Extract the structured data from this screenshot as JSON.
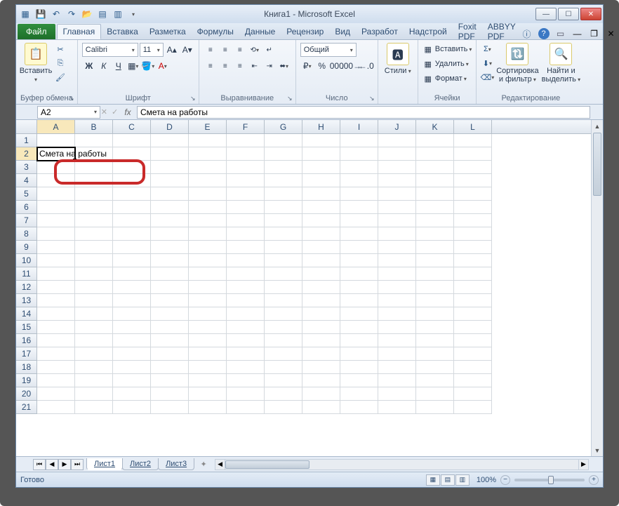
{
  "title": "Книга1  -  Microsoft Excel",
  "tabs": {
    "file": "Файл",
    "list": [
      "Главная",
      "Вставка",
      "Разметка",
      "Формулы",
      "Данные",
      "Рецензир",
      "Вид",
      "Разработ",
      "Надстрой",
      "Foxit PDF",
      "ABBYY PDF"
    ],
    "active": "Главная"
  },
  "ribbon": {
    "clipboard": {
      "paste": "Вставить",
      "label": "Буфер обмена"
    },
    "font": {
      "name": "Calibri",
      "size": "11",
      "label": "Шрифт"
    },
    "align": {
      "label": "Выравнивание"
    },
    "number": {
      "format": "Общий",
      "label": "Число"
    },
    "styles": {
      "btn": "Стили"
    },
    "cells": {
      "insert": "Вставить",
      "delete": "Удалить",
      "format": "Формат",
      "label": "Ячейки"
    },
    "editing": {
      "sort": "Сортировка и фильтр",
      "find": "Найти и выделить",
      "label": "Редактирование"
    }
  },
  "namebox": "A2",
  "formula": "Смета на работы",
  "columns": [
    "A",
    "B",
    "C",
    "D",
    "E",
    "F",
    "G",
    "H",
    "I",
    "J",
    "K",
    "L"
  ],
  "active_col": "A",
  "rows": 21,
  "active_row": 2,
  "cell_A2": "Смета на работы",
  "sheets": [
    "Лист1",
    "Лист2",
    "Лист3"
  ],
  "active_sheet": "Лист1",
  "status": "Готово",
  "zoom": "100%"
}
